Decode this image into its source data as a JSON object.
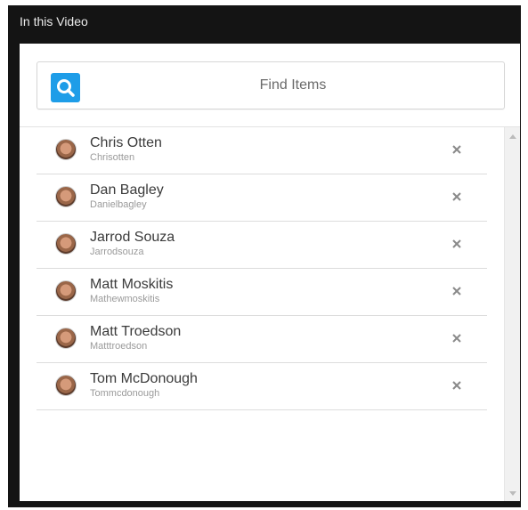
{
  "window": {
    "title": "In this Video"
  },
  "search": {
    "placeholder": "Find Items",
    "icon": "search-icon",
    "accent": "#1e9de8"
  },
  "people": [
    {
      "name": "Chris Otten",
      "handle": "Chrisotten",
      "remove_icon": "close-icon"
    },
    {
      "name": "Dan Bagley",
      "handle": "Danielbagley",
      "remove_icon": "close-icon"
    },
    {
      "name": "Jarrod Souza",
      "handle": "Jarrodsouza",
      "remove_icon": "close-icon"
    },
    {
      "name": "Matt Moskitis",
      "handle": "Mathewmoskitis",
      "remove_icon": "close-icon"
    },
    {
      "name": "Matt Troedson",
      "handle": "Matttroedson",
      "remove_icon": "close-icon"
    },
    {
      "name": "Tom McDonough",
      "handle": "Tommcdonough",
      "remove_icon": "close-icon"
    }
  ]
}
